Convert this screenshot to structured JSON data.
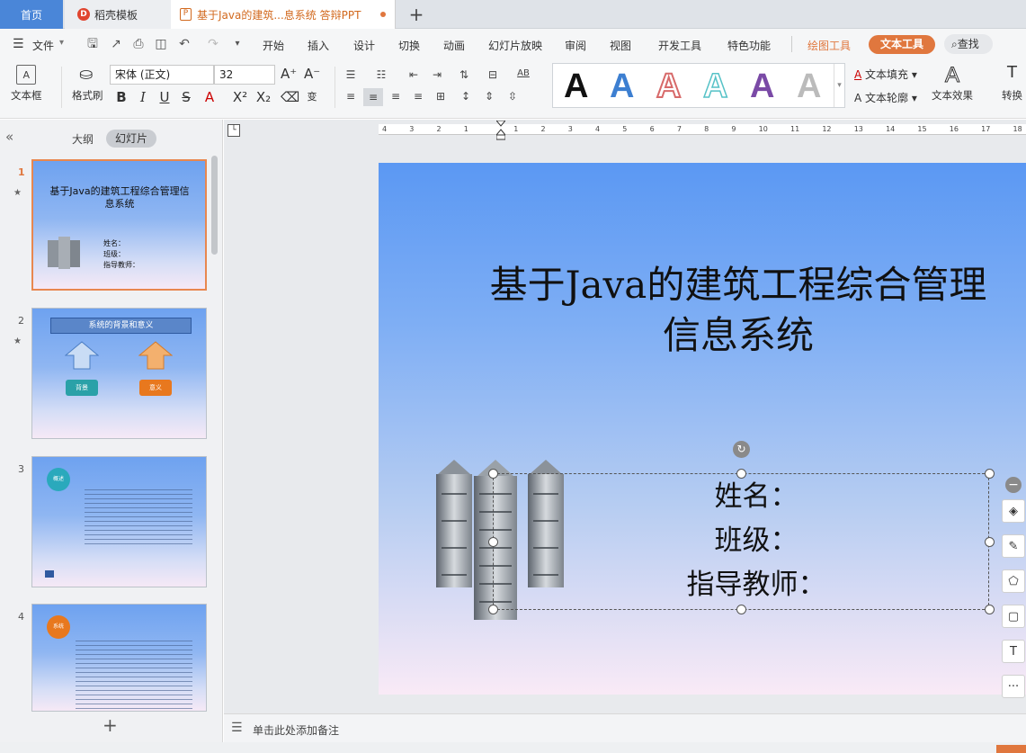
{
  "tabs": {
    "home": "首页",
    "template": "稻壳模板",
    "doc": "基于Java的建筑...息系统 答辩PPT",
    "add": "+"
  },
  "menu": {
    "file": "文件",
    "items": [
      "开始",
      "插入",
      "设计",
      "切换",
      "动画",
      "幻灯片放映",
      "审阅",
      "视图",
      "开发工具",
      "特色功能"
    ],
    "draw_tool": "绘图工具",
    "text_tool": "文本工具",
    "search": "查找"
  },
  "toolbar": {
    "textbox": "文本框",
    "format_painter": "格式刷",
    "font": "宋体 (正文)",
    "size": "32",
    "text_fill": "文本填充",
    "text_outline": "文本轮廓",
    "text_effect": "文本效果",
    "convert": "转换"
  },
  "colors": {
    "accent": "#e0773e",
    "blue_tab": "#4a86d8",
    "brand": "#d2691e"
  },
  "left_panel": {
    "outline": "大纲",
    "slides": "幻灯片",
    "add": "+"
  },
  "thumbs": [
    {
      "num": "1",
      "title": "基于Java的建筑工程综合管理信息系统",
      "lines": [
        "姓名：",
        "班级：",
        "指导教师："
      ]
    },
    {
      "num": "2",
      "banner": "系统的背景和意义",
      "btn1": "背景",
      "btn2": "意义"
    },
    {
      "num": "3",
      "circle": "概述"
    },
    {
      "num": "4",
      "circle": "系统"
    }
  ],
  "slide": {
    "title1": "基于Java的建筑工程综合管理",
    "title2": "信息系统",
    "info": [
      "姓名：",
      "班级：",
      "指导教师："
    ]
  },
  "ruler": {
    "marks": [
      "4",
      "3",
      "2",
      "1",
      "",
      "1",
      "2",
      "3",
      "4",
      "5",
      "6",
      "7",
      "8",
      "9",
      "10",
      "11",
      "12",
      "13",
      "14",
      "15",
      "16",
      "17",
      "18"
    ]
  },
  "notes": "单击此处添加备注",
  "more": "···"
}
